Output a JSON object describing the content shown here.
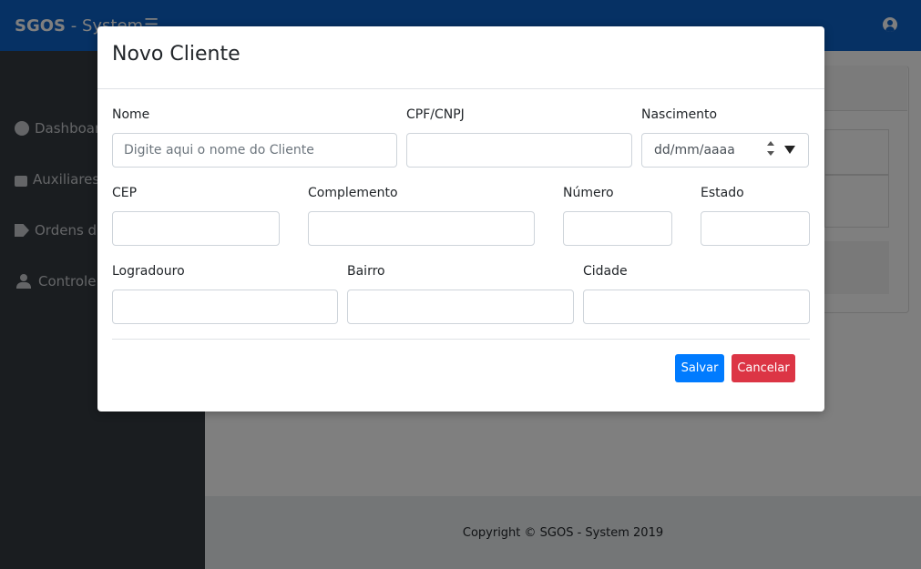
{
  "app": {
    "brand_bold": "SGOS",
    "brand_rest": " - System",
    "menu_icon": "hamburger-icon",
    "user_icon": "user-circle-icon"
  },
  "sidebar": {
    "items": [
      {
        "label": "Dashboard",
        "icon": "tachometer-icon"
      },
      {
        "label": "Auxiliares",
        "icon": "shopping-bag-icon"
      },
      {
        "label": "Ordens de Serviço",
        "icon": "tags-icon"
      },
      {
        "label": "Controle de Usuários",
        "icon": "users-icon"
      }
    ]
  },
  "footer": {
    "copyright": "Copyright © SGOS - System 2019"
  },
  "modal": {
    "title": "Novo Cliente",
    "fields": {
      "nome": {
        "label": "Nome",
        "placeholder": "Digite aqui o nome do Cliente",
        "value": ""
      },
      "cpf": {
        "label": "CPF/CNPJ",
        "value": ""
      },
      "nascimento": {
        "label": "Nascimento",
        "placeholder": "dd/mm/aaaa"
      },
      "cep": {
        "label": "CEP",
        "value": ""
      },
      "complemento": {
        "label": "Complemento",
        "value": ""
      },
      "numero": {
        "label": "Número",
        "value": ""
      },
      "estado": {
        "label": "Estado",
        "value": ""
      },
      "logradouro": {
        "label": "Logradouro",
        "value": ""
      },
      "bairro": {
        "label": "Bairro",
        "value": ""
      },
      "cidade": {
        "label": "Cidade",
        "value": ""
      }
    },
    "buttons": {
      "save": "Salvar",
      "cancel": "Cancelar"
    }
  },
  "colors": {
    "primary": "#007bff",
    "danger": "#dc3545",
    "navbar": "#0d62c8",
    "sidebar": "#343a40"
  }
}
